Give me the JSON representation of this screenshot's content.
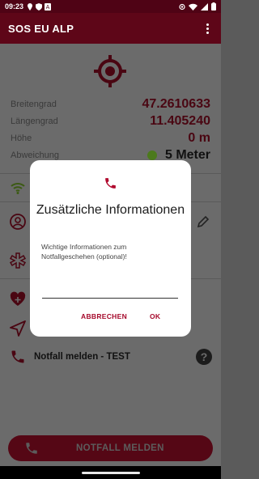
{
  "status_bar": {
    "time": "09:23",
    "left_icons": [
      "pin-icon",
      "shield-icon",
      "a-icon"
    ],
    "right_icons": [
      "location-icon",
      "wifi-icon",
      "signal-icon",
      "battery-icon"
    ]
  },
  "app_bar": {
    "title": "SOS EU ALP",
    "menu_icon": "more-vert-icon"
  },
  "location": {
    "icon": "gps-target-icon",
    "rows": [
      {
        "label": "Breitengrad",
        "value": "47.2610633"
      },
      {
        "label": "Längengrad",
        "value": "11.405240"
      },
      {
        "label": "Höhe",
        "value": "0 m"
      },
      {
        "label": "Abweichung",
        "value": "5 Meter"
      }
    ]
  },
  "sections": {
    "icons": [
      "wifi-icon",
      "person-icon",
      "medical-icon",
      "heart-plus-icon",
      "navigation-icon"
    ],
    "edit_icon": "pencil-icon"
  },
  "report_row": {
    "icon": "phone-icon",
    "label": "Notfall melden - TEST",
    "help_icon": "help-icon",
    "help_glyph": "?"
  },
  "main_button": {
    "label": "NOTFALL MELDEN",
    "icon": "phone-icon"
  },
  "dialog": {
    "icon": "phone-icon",
    "title": "Zusätzliche Informationen",
    "message": "Wichtige Informationen zum Notfallgeschehen (optional)!",
    "input_value": "",
    "cancel_label": "ABBRECHEN",
    "ok_label": "OK"
  },
  "colors": {
    "accent": "#B10A2E",
    "status_ok": "#4C7A1C"
  }
}
